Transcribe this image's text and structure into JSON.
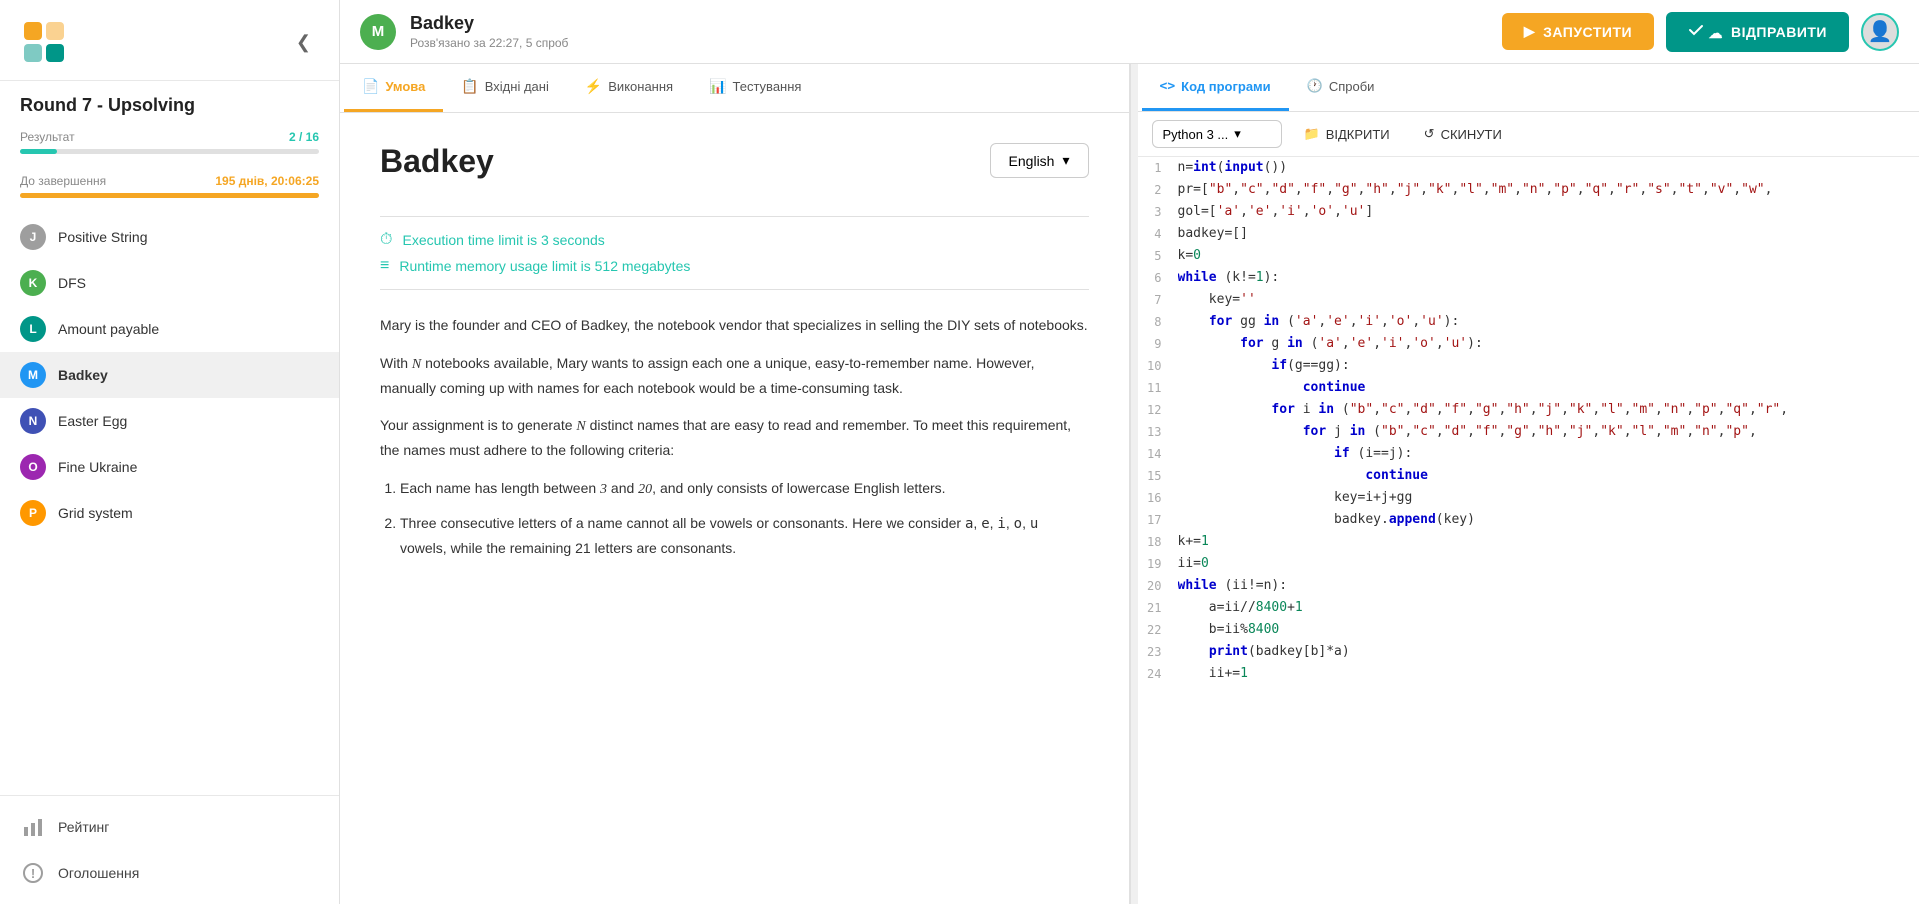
{
  "sidebar": {
    "title": "Round 7 - Upsolving",
    "collapse_icon": "❮",
    "result_label": "Результат",
    "result_value": "2 / 16",
    "result_progress": 12.5,
    "deadline_label": "До завершення",
    "deadline_value": "195 днів, 20:06:25",
    "deadline_progress": 100,
    "nav_items": [
      {
        "badge": "J",
        "label": "Positive String",
        "color": "badge-gray"
      },
      {
        "badge": "K",
        "label": "DFS",
        "color": "badge-green"
      },
      {
        "badge": "L",
        "label": "Amount payable",
        "color": "badge-teal"
      },
      {
        "badge": "M",
        "label": "Badkey",
        "color": "badge-blue",
        "active": true
      },
      {
        "badge": "N",
        "label": "Easter Egg",
        "color": "badge-indigo"
      },
      {
        "badge": "O",
        "label": "Fine Ukraine",
        "color": "badge-purple"
      },
      {
        "badge": "P",
        "label": "Grid system",
        "color": "badge-orange"
      }
    ],
    "bottom_items": [
      {
        "icon": "📊",
        "label": "Рейтинг"
      },
      {
        "icon": "!",
        "label": "Оголошення"
      }
    ]
  },
  "header": {
    "problem_avatar": "M",
    "problem_title": "Badkey",
    "problem_meta": "Розв'язано за 22:27, 5 спроб",
    "btn_run": "ЗАПУСТИТИ",
    "btn_submit": "ВІДПРАВИТИ"
  },
  "problem_tabs": [
    {
      "label": "Умова",
      "icon": "📄",
      "active": true
    },
    {
      "label": "Вхідні дані",
      "icon": "📋",
      "active": false
    },
    {
      "label": "Виконання",
      "icon": "⚡",
      "active": false
    },
    {
      "label": "Тестування",
      "icon": "📊",
      "active": false
    }
  ],
  "problem": {
    "title": "Badkey",
    "language": "English",
    "time_limit": "Execution time limit is 3 seconds",
    "memory_limit": "Runtime memory usage limit is 512 megabytes",
    "description_p1": "Mary is the founder and CEO of Badkey, the notebook vendor that specializes in selling the DIY sets of notebooks.",
    "description_p2": "With N notebooks available, Mary wants to assign each one a unique, easy-to-remember name. However, manually coming up with names for each notebook would be a time-consuming task.",
    "description_p3": "Your assignment is to generate N distinct names that are easy to read and remember. To meet this requirement, the names must adhere to the following criteria:",
    "criteria_1": "Each name has length between 3 and 20, and only consists of lowercase English letters.",
    "criteria_2": "Three consecutive letters of a name cannot all be vowels or consonants. Here we consider a, e, i, o, u vowels, while the remaining 21 letters are consonants."
  },
  "code_tabs": [
    {
      "label": "Код програми",
      "icon": "<>",
      "active": true
    },
    {
      "label": "Спроби",
      "icon": "🕐",
      "active": false
    }
  ],
  "code_toolbar": {
    "language": "Python 3 ...",
    "open_label": "ВІДКРИТИ",
    "reset_label": "СКИНУТИ"
  },
  "code_lines": [
    {
      "num": 1,
      "code": "n=int(input())"
    },
    {
      "num": 2,
      "code": "pr=[\"b\",\"c\",\"d\",\"f\",\"g\",\"h\",\"j\",\"k\",\"l\",\"m\",\"n\",\"p\",\"q\",\"r\",\"s\",\"t\",\"v\",\"w\","
    },
    {
      "num": 3,
      "code": "gol=['a','e','i','o','u']"
    },
    {
      "num": 4,
      "code": "badkey=[]"
    },
    {
      "num": 5,
      "code": "k=0"
    },
    {
      "num": 6,
      "code": "while (k!=1):"
    },
    {
      "num": 7,
      "code": "    key=''"
    },
    {
      "num": 8,
      "code": "    for gg in ('a','e','i','o','u'):"
    },
    {
      "num": 9,
      "code": "        for g in ('a','e','i','o','u'):"
    },
    {
      "num": 10,
      "code": "            if(g==gg):"
    },
    {
      "num": 11,
      "code": "                continue"
    },
    {
      "num": 12,
      "code": "            for i in (\"b\",\"c\",\"d\",\"f\",\"g\",\"h\",\"j\",\"k\",\"l\",\"m\",\"n\",\"p\",\"q\",\"r\","
    },
    {
      "num": 13,
      "code": "                for j in (\"b\",\"c\",\"d\",\"f\",\"g\",\"h\",\"j\",\"k\",\"l\",\"m\",\"n\",\"p\","
    },
    {
      "num": 14,
      "code": "                    if (i==j):"
    },
    {
      "num": 15,
      "code": "                        continue"
    },
    {
      "num": 16,
      "code": "                    key=i+j+gg"
    },
    {
      "num": 17,
      "code": "                    badkey.append(key)"
    },
    {
      "num": 18,
      "code": "k+=1"
    },
    {
      "num": 19,
      "code": "ii=0"
    },
    {
      "num": 20,
      "code": "while (ii!=n):"
    },
    {
      "num": 21,
      "code": "    a=ii//8400+1"
    },
    {
      "num": 22,
      "code": "    b=ii%8400"
    },
    {
      "num": 23,
      "code": "    print(badkey[b]*a)"
    },
    {
      "num": 24,
      "code": "    ii+=1"
    }
  ]
}
